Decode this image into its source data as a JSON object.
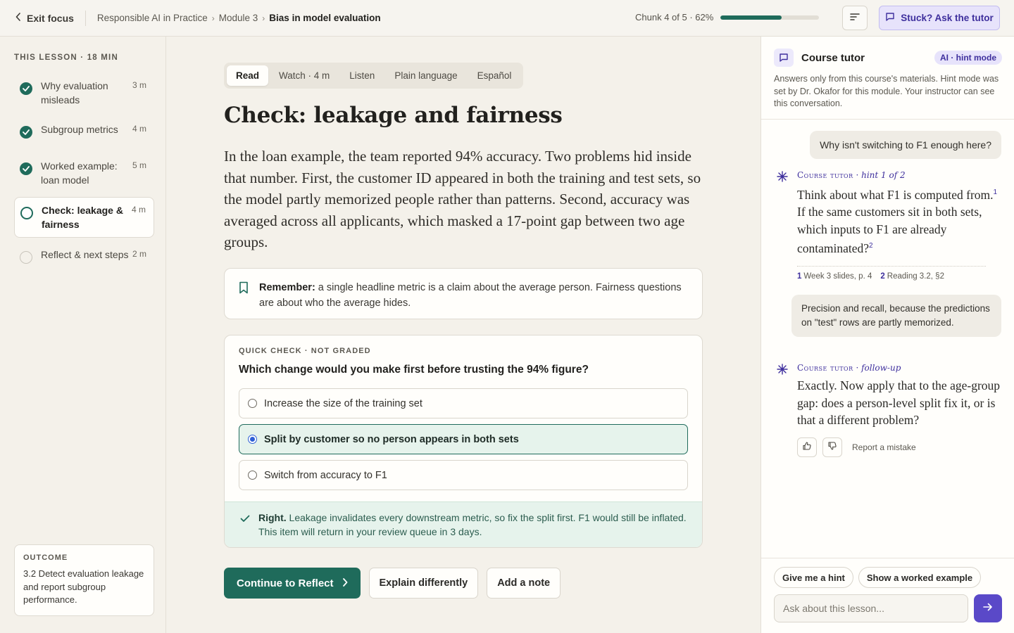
{
  "topbar": {
    "exit_label": "Exit focus",
    "breadcrumbs": [
      "Responsible AI in Practice",
      "Module 3",
      "Bias in model evaluation"
    ],
    "progress_text": "Chunk 4 of 5 · 62%",
    "progress_fraction": 0.62,
    "stuck_label": "Stuck? Ask the tutor"
  },
  "sidebar": {
    "heading": "THIS LESSON · 18 MIN",
    "steps": [
      {
        "label": "Why evaluation misleads",
        "duration": "3 m",
        "status": "done"
      },
      {
        "label": "Subgroup metrics",
        "duration": "4 m",
        "status": "done"
      },
      {
        "label": "Worked example: loan model",
        "duration": "5 m",
        "status": "done"
      },
      {
        "label": "Check: leakage & fairness",
        "duration": "4 m",
        "status": "current"
      },
      {
        "label": "Reflect & next steps",
        "duration": "2 m",
        "status": "todo"
      }
    ],
    "outcome": {
      "title": "OUTCOME",
      "text": "3.2 Detect evaluation leakage and report subgroup performance."
    }
  },
  "main": {
    "tabs": [
      "Read",
      "Watch · 4 m",
      "Listen",
      "Plain language",
      "Español"
    ],
    "selected_tab": 0,
    "title": "Check: leakage and fairness",
    "body": "In the loan example, the team reported 94% accuracy. Two problems hid inside that number. First, the customer ID appeared in both the training and test sets, so the model partly memorized people rather than patterns. Second, accuracy was averaged across all applicants, which masked a 17-point gap between two age groups.",
    "remember": {
      "label": "Remember:",
      "text": " a single headline metric is a claim about the average person. Fairness questions are about who the average hides."
    },
    "quiz": {
      "header": "QUICK CHECK · NOT GRADED",
      "question": "Which change would you make first before trusting the 94% figure?",
      "options": [
        "Increase the size of the training set",
        "Split by customer so no person appears in both sets",
        "Switch from accuracy to F1"
      ],
      "selected": 1,
      "feedback_label": "Right.",
      "feedback_text": " Leakage invalidates every downstream metric, so fix the split first. F1 would still be inflated. This item will return in your review queue in 3 days."
    },
    "actions": {
      "continue": "Continue to Reflect",
      "explain": "Explain differently",
      "note": "Add a note"
    }
  },
  "tutor": {
    "title": "Course tutor",
    "badge": "AI · hint mode",
    "description": "Answers only from this course's materials. Hint mode was set by Dr. Okafor for this module. Your instructor can see this conversation.",
    "messages": [
      {
        "role": "user",
        "text": "Why isn't switching to F1 enough here?"
      },
      {
        "role": "tutor",
        "name": "Course tutor",
        "tag": "hint 1 of 2",
        "text_parts": [
          "Think about what F1 is computed from.",
          "1",
          " If the same customers sit in both sets, which inputs to F1 are already contaminated?",
          "2"
        ]
      },
      {
        "role": "user",
        "text": "Precision and recall, because the predictions on \"test\" rows are partly memorized."
      },
      {
        "role": "tutor",
        "name": "Course tutor",
        "tag": "follow-up",
        "text": "Exactly. Now apply that to the age-group gap: does a person-level split fix it, or is that a different problem?"
      }
    ],
    "refs": [
      {
        "n": "1",
        "text": "Week 3 slides, p. 4"
      },
      {
        "n": "2",
        "text": "Reading 3.2, §2"
      }
    ],
    "report_label": "Report a mistake",
    "chips": [
      "Give me a hint",
      "Show a worked example"
    ],
    "input_placeholder": "Ask about this lesson..."
  },
  "colors": {
    "accent": "#1f6b5b",
    "tutor_accent": "#5a49c8"
  }
}
